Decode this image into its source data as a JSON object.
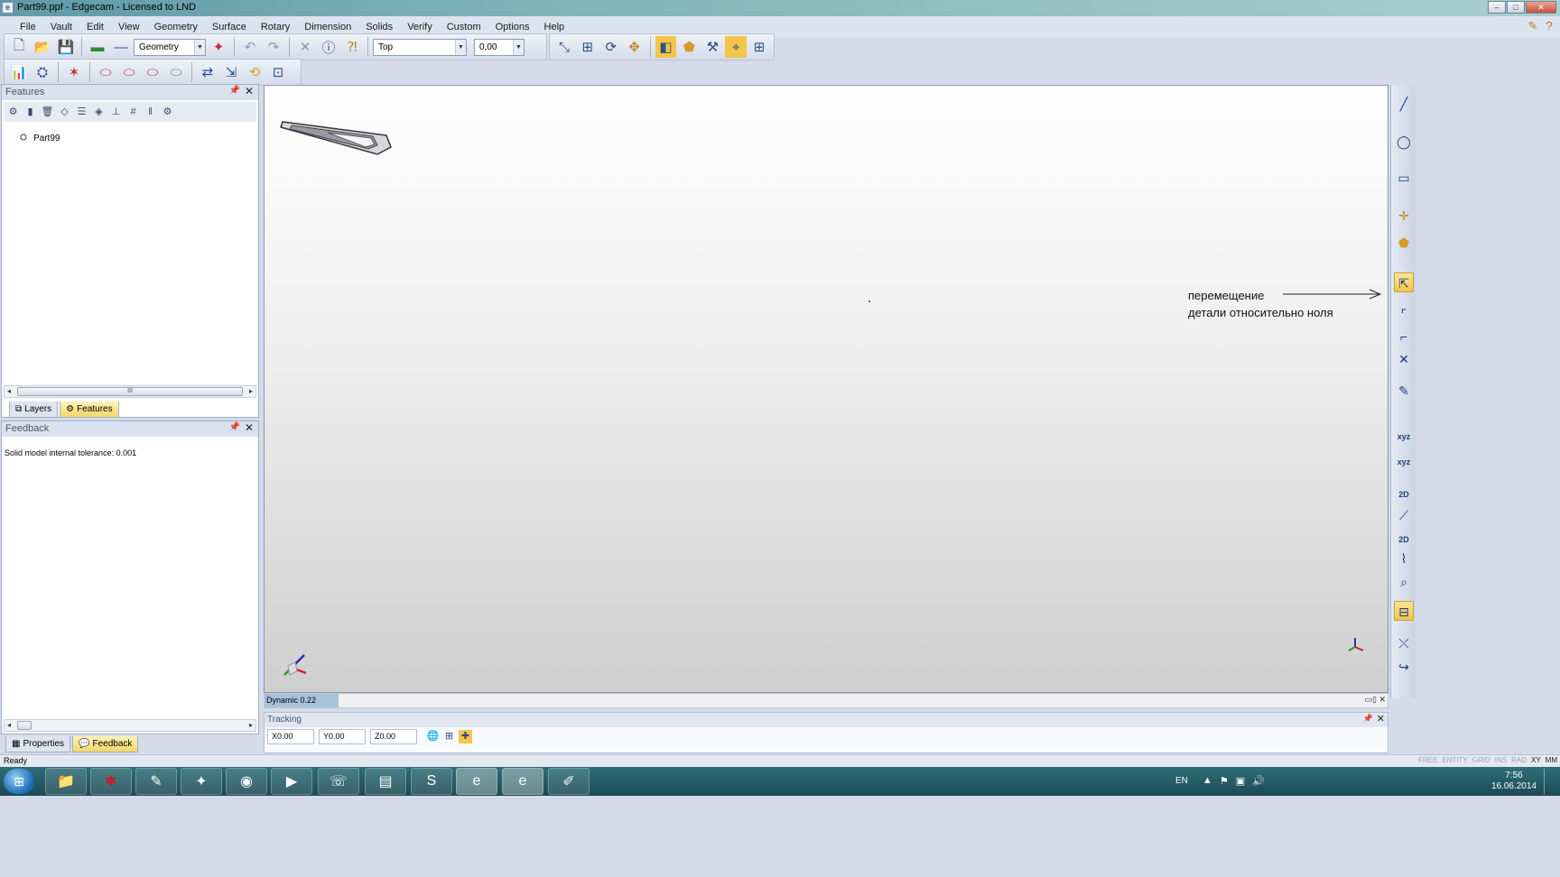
{
  "window": {
    "title": "Part99.ppf - Edgecam - Licensed to LND",
    "app_icon": "e",
    "buttons": {
      "minimize": "–",
      "maximize": "□",
      "close": "✕"
    }
  },
  "menu": [
    "File",
    "Vault",
    "Edit",
    "View",
    "Geometry",
    "Surface",
    "Rotary",
    "Dimension",
    "Solids",
    "Verify",
    "Custom",
    "Options",
    "Help"
  ],
  "toolbar": {
    "layer_combo": "Geometry",
    "view_combo": "Top",
    "depth_combo": "0,00"
  },
  "features_panel": {
    "title": "Features",
    "root_item": "Part99",
    "tabs": [
      "Layers",
      "Features"
    ],
    "active_tab": "Features"
  },
  "feedback_panel": {
    "title": "Feedback",
    "message": "Solid model internal tolerance: 0.001",
    "tabs": [
      "Properties",
      "Feedback"
    ],
    "active_tab": "Feedback"
  },
  "viewport": {
    "dynamic_label": "Dynamic 0.22",
    "annotation_line1": "перемещение",
    "annotation_line2": "детали относительно ноля"
  },
  "tracking": {
    "title": "Tracking",
    "x": "X0.00",
    "y": "Y0.00",
    "z": "Z0.00"
  },
  "status": {
    "text": "Ready",
    "flags": [
      "FREE",
      "ENTITY",
      "GRID",
      "INS",
      "RAD",
      "XY",
      "MM"
    ]
  },
  "tray": {
    "lang": "EN",
    "time": "7:56",
    "date": "16.06.2014"
  },
  "colors": {
    "accent_highlight": "#f3c54a",
    "titlebar": "#7bb0b8",
    "taskbar": "#1c4a55"
  }
}
